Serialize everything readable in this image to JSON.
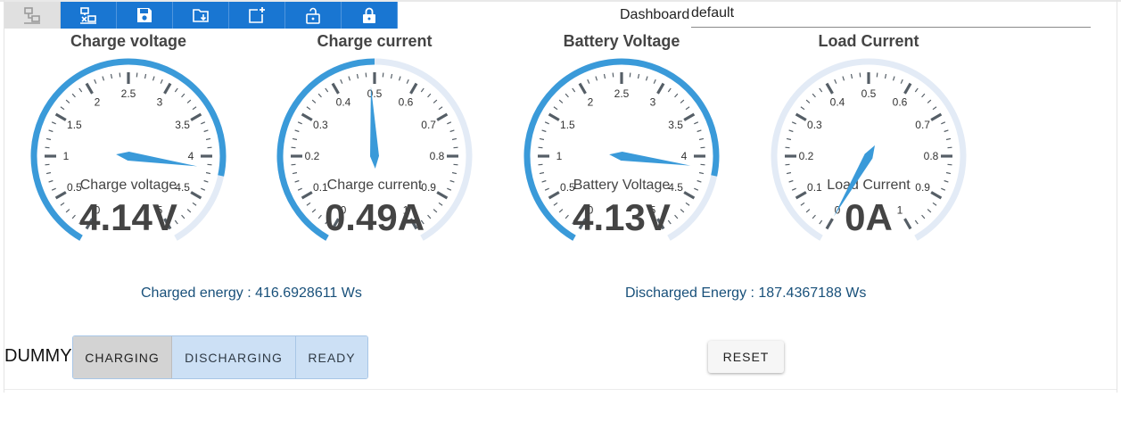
{
  "toolbar": {
    "buttons": [
      {
        "icon": "network-connected-icon",
        "state": "disabled"
      },
      {
        "icon": "network-disconnect-icon",
        "state": "enabled"
      },
      {
        "icon": "save-icon",
        "state": "enabled"
      },
      {
        "icon": "folder-download-icon",
        "state": "enabled"
      },
      {
        "icon": "add-widget-icon",
        "state": "enabled"
      },
      {
        "icon": "lock-open-icon",
        "state": "enabled"
      },
      {
        "icon": "lock-closed-icon",
        "state": "enabled"
      }
    ],
    "accent": "#1976d2"
  },
  "dashboard": {
    "label": "Dashboard",
    "name": "default"
  },
  "gauges": [
    {
      "title": "Charge voltage",
      "label": "Charge voltage",
      "value_text": "4.14V",
      "value": 4.14,
      "min": 0,
      "max": 5,
      "ticks": [
        "0",
        "0.5",
        "1",
        "1.5",
        "2",
        "2.5",
        "3",
        "3.5",
        "4",
        "4.5",
        "5"
      ],
      "arc_fraction": 0.84
    },
    {
      "title": "Charge current",
      "label": "Charge current",
      "value_text": "0.49A",
      "value": 0.49,
      "min": 0,
      "max": 1,
      "ticks": [
        "0",
        "0.1",
        "0.2",
        "0.3",
        "0.4",
        "0.5",
        "0.6",
        "0.7",
        "0.8",
        "0.9",
        "1"
      ],
      "arc_fraction": 0.5
    },
    {
      "title": "Battery Voltage",
      "label": "Battery Voltage",
      "value_text": "4.13V",
      "value": 4.13,
      "min": 0,
      "max": 5,
      "ticks": [
        "0",
        "0.5",
        "1",
        "1.5",
        "2",
        "2.5",
        "3",
        "3.5",
        "4",
        "4.5",
        "5"
      ],
      "arc_fraction": 0.84
    },
    {
      "title": "Load Current",
      "label": "Load Current",
      "value_text": "0A",
      "value": 0.0,
      "min": 0,
      "max": 1,
      "ticks": [
        "0",
        "0.1",
        "0.2",
        "0.3",
        "0.4",
        "0.5",
        "0.6",
        "0.7",
        "0.8",
        "0.9",
        "1"
      ],
      "arc_fraction": 0.0
    }
  ],
  "energy": {
    "charged": "Charged energy : 416.6928611 Ws",
    "discharged": "Discharged Energy : 187.4367188 Ws"
  },
  "mode": {
    "label": "DUMMY",
    "options": [
      "CHARGING",
      "DISCHARGING",
      "READY"
    ],
    "selected": "CHARGING"
  },
  "reset_label": "RESET",
  "colors": {
    "gauge_fill": "#3a9ad9",
    "gauge_track": "#e3ebf6",
    "tick": "#555e66",
    "energy_text": "#18507a"
  }
}
